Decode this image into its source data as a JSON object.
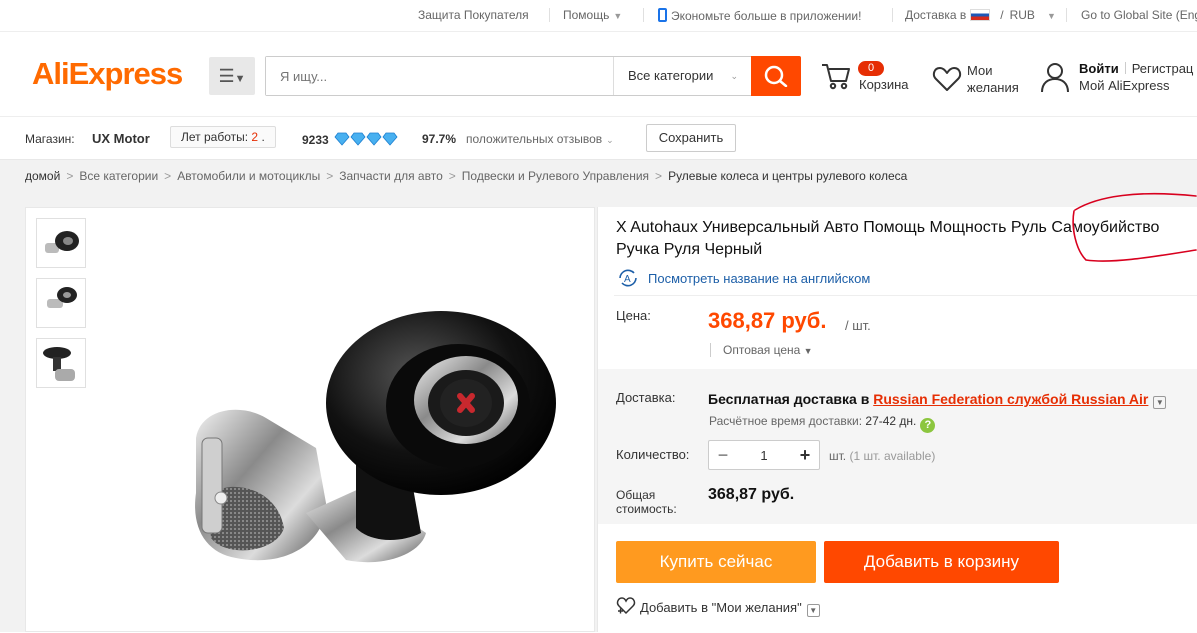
{
  "topbar": {
    "buyer_protection": "Защита Покупателя",
    "help": "Помощь",
    "app_promo": "Экономьте больше в приложении!",
    "ship_to": "Доставка в",
    "currency_sep": "/",
    "currency": "RUB",
    "global_site": "Go to Global Site (Englis"
  },
  "header": {
    "logo": "AliExpress",
    "search_placeholder": "Я ищу...",
    "category": "Все категории",
    "cart_count": "0",
    "cart_label": "Корзина",
    "wishlist_label": "Мои желания",
    "signin": "Войти",
    "register": "Регистрац",
    "my_account": "Мой AliExpress"
  },
  "store": {
    "label": "Магазин:",
    "name": "UX Motor",
    "years_label": "Лет работы:",
    "years_value": "2",
    "years_dot": ".",
    "score": "9233",
    "positive_pct": "97.7%",
    "positive_label": "положительных отзывов",
    "save": "Сохранить"
  },
  "breadcrumb": [
    "домой",
    "Все категории",
    "Автомобили и мотоциклы",
    "Запчасти для авто",
    "Подвески и Рулевого Управления",
    "Рулевые колеса и центры рулевого колеса"
  ],
  "product": {
    "title": "X Autohaux Универсальный Авто Помощь Мощность Руль Самоубийство Ручка Руля Черный",
    "translate_link": "Посмотреть название на английском",
    "price_label": "Цена:",
    "price": "368,87 руб.",
    "per_unit": "/ шт.",
    "wholesale": "Оптовая цена",
    "shipping_label": "Доставка:",
    "shipping_free": "Бесплатная доставка в",
    "shipping_link": "Russian Federation службой Russian Air",
    "ship_time_label": "Расчётное время доставки:",
    "ship_time_value": "27-42 дн.",
    "quantity_label": "Количество:",
    "quantity_value": "1",
    "quantity_unit": "шт.",
    "quantity_avail": "(1 шт. available)",
    "total_label": "Общая стоимость:",
    "total_value": "368,87 руб.",
    "buy_now": "Купить сейчас",
    "add_to_cart": "Добавить в корзину",
    "add_wishlist": "Добавить в \"Мои желания\""
  },
  "colors": {
    "brand_orange": "#ff6a00",
    "action_red": "#ff4800",
    "buy_orange": "#ff9a1f",
    "link_blue": "#1d5fa8",
    "annotation_red": "#d8001e"
  }
}
